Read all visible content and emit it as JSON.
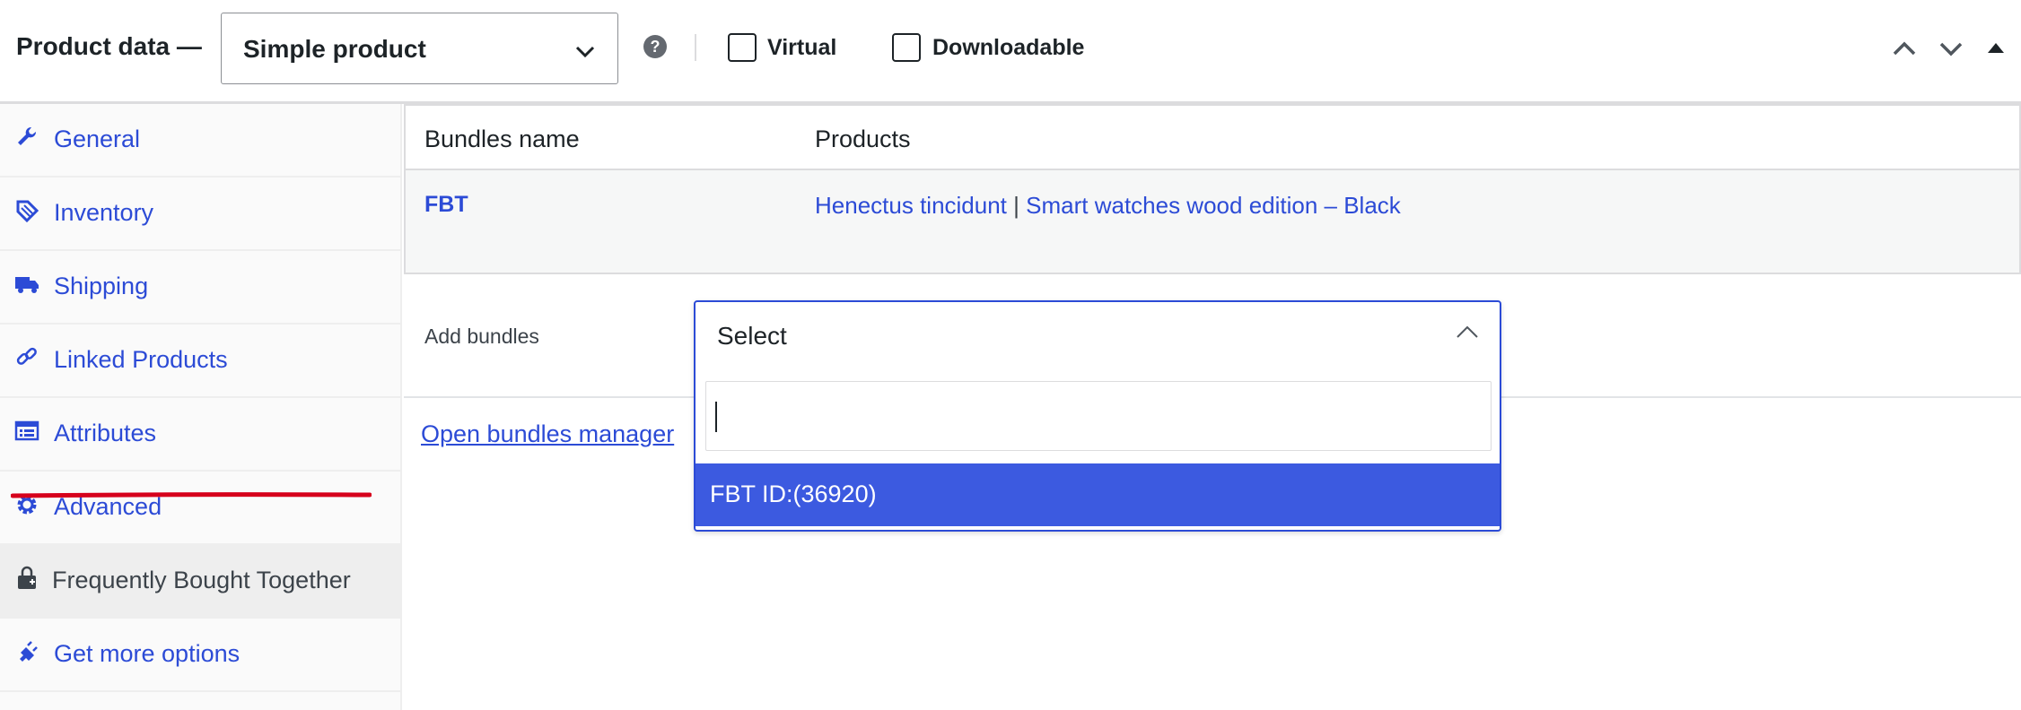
{
  "header": {
    "title": "Product data —",
    "product_type": "Simple product",
    "help": "?",
    "virtual_label": "Virtual",
    "downloadable_label": "Downloadable"
  },
  "sidebar": {
    "items": [
      {
        "label": "General",
        "icon": "wrench-icon"
      },
      {
        "label": "Inventory",
        "icon": "tag-icon"
      },
      {
        "label": "Shipping",
        "icon": "truck-icon"
      },
      {
        "label": "Linked Products",
        "icon": "link-icon"
      },
      {
        "label": "Attributes",
        "icon": "list-icon"
      },
      {
        "label": "Advanced",
        "icon": "gear-icon"
      },
      {
        "label": "Frequently Bought Together",
        "icon": "bag-icon"
      },
      {
        "label": "Get more options",
        "icon": "plugin-icon"
      }
    ],
    "active_index": 6
  },
  "bundles_table": {
    "headers": [
      "Bundles name",
      "Products"
    ],
    "rows": [
      {
        "name": "FBT",
        "product_1": "Henectus tincidunt",
        "separator": "|",
        "product_2": "Smart watches wood edition – Black"
      }
    ]
  },
  "add_bundles": {
    "label": "Add bundles",
    "select_value": "Select",
    "search_value": "",
    "options": [
      "FBT ID:(36920)"
    ]
  },
  "open_manager_link": "Open bundles manager",
  "colors": {
    "link": "#2c4bd6",
    "highlight": "#3c5ae0",
    "annotation": "#d6001c"
  }
}
